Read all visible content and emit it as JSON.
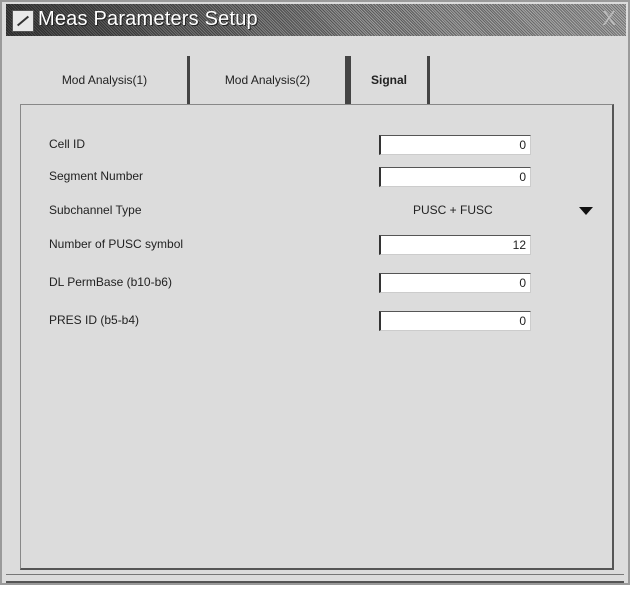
{
  "window": {
    "title": "Meas Parameters Setup",
    "close_label": "X"
  },
  "tabs": [
    {
      "label": "Mod Analysis(1)",
      "active": false
    },
    {
      "label": "Mod Analysis(2)",
      "active": false
    },
    {
      "label": "Signal",
      "active": true
    }
  ],
  "fields": {
    "cell_id": {
      "label": "Cell ID",
      "value": "0"
    },
    "segment_number": {
      "label": "Segment Number",
      "value": "0"
    },
    "subchannel_type": {
      "label": "Subchannel Type",
      "value": "PUSC + FUSC"
    },
    "pusc_symbols": {
      "label": "Number of PUSC symbol",
      "value": "12"
    },
    "dl_permbase": {
      "label": "DL PermBase (b10-b6)",
      "value": "0"
    },
    "pres_id": {
      "label": "PRES ID (b5-b4)",
      "value": "0"
    }
  },
  "icons": {
    "app": "app-icon",
    "close": "close-icon",
    "dropdown": "chevron-down-icon"
  }
}
